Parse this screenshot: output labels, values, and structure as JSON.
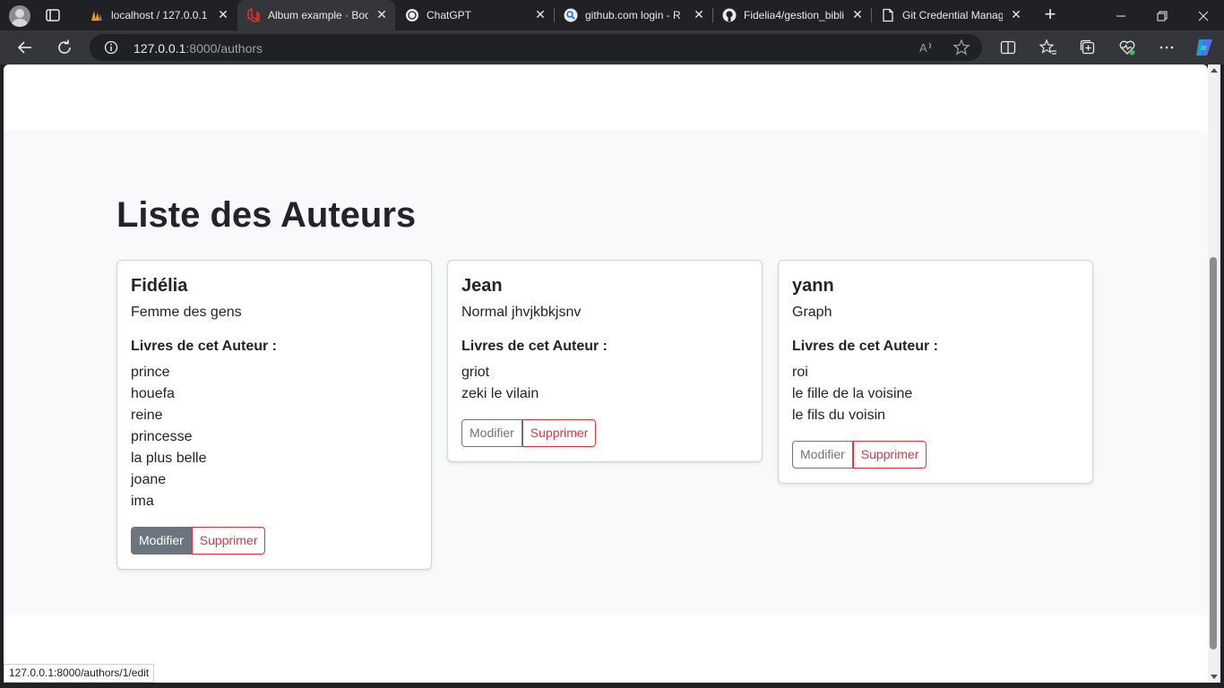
{
  "browser": {
    "tabs": [
      {
        "title": "localhost / 127.0.0.1 |",
        "favicon": "phpmyadmin-icon",
        "active": false
      },
      {
        "title": "Album example · Boo",
        "favicon": "laravel-icon",
        "active": true
      },
      {
        "title": "ChatGPT",
        "favicon": "chatgpt-icon",
        "active": false
      },
      {
        "title": "github.com login - R",
        "favicon": "search-icon",
        "active": false
      },
      {
        "title": "Fidelia4/gestion_bibli",
        "favicon": "github-icon",
        "active": false
      },
      {
        "title": "Git Credential Manag",
        "favicon": "document-icon",
        "active": false
      }
    ],
    "address": {
      "host": "127.0.0.1",
      "path": ":8000/authors"
    },
    "status_url": "127.0.0.1:8000/authors/1/edit"
  },
  "page": {
    "title": "Liste des Auteurs",
    "books_heading": "Livres de cet Auteur :",
    "edit_label": "Modifier",
    "delete_label": "Supprimer",
    "authors": [
      {
        "name": "Fidélia",
        "bio": "Femme des gens",
        "books": [
          "prince",
          "houefa",
          "reine",
          "princesse",
          "la plus belle",
          "joane",
          "ima"
        ],
        "edit_hovered": true
      },
      {
        "name": "Jean",
        "bio": "Normal jhvjkbkjsnv",
        "books": [
          "griot",
          "zeki le vilain"
        ],
        "edit_hovered": false
      },
      {
        "name": "yann",
        "bio": "Graph",
        "books": [
          "roi",
          "le fille de la voisine",
          "le fils du voisin"
        ],
        "edit_hovered": false
      }
    ]
  },
  "colors": {
    "secondary": "#6c757d",
    "danger": "#dc3545",
    "album_bg": "#f8f9fa",
    "chrome_dark": "#202124"
  }
}
